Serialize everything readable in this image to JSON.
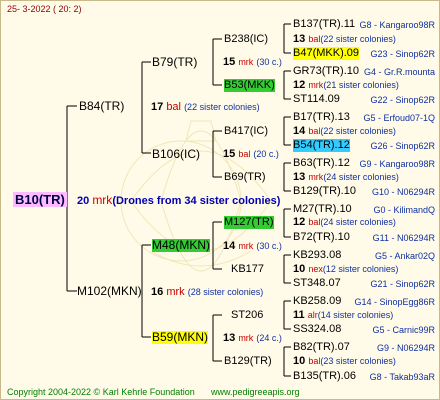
{
  "header": {
    "date": "25- 3-2022 ( 20: 2)"
  },
  "root": {
    "id": "B10(TR)",
    "drones_num": "20",
    "drones_abbr": "mrk",
    "drones_text": "(Drones from 34 sister colonies)"
  },
  "gen1": [
    {
      "id": "B84(TR)",
      "num": "17",
      "abbr": "bal",
      "sisters": "(22 sister colonies)"
    },
    {
      "id": "M102(MKN)",
      "num": "16",
      "abbr": "mrk",
      "sisters": "(28 sister colonies)"
    }
  ],
  "gen2": [
    {
      "id": "B79(TR)",
      "num": "15",
      "abbr": "mrk",
      "sisters": "(30 c.)"
    },
    {
      "id": "B106(IC)",
      "num": "15",
      "abbr": "bal",
      "sisters": "(20 c.)"
    },
    {
      "id": "M48(MKN)",
      "num": "14",
      "abbr": "mrk",
      "sisters": "(30 c.)"
    },
    {
      "id": "B59(MKN)",
      "num": "13",
      "abbr": "mrk",
      "sisters": "(24 c.)"
    }
  ],
  "gen3": [
    {
      "id": "B238(IC)",
      "num": "13",
      "abbr": "bal",
      "sisters": "(22 sister colonies)"
    },
    {
      "id": "B53(MKK)",
      "num": "12",
      "abbr": "mrk",
      "sisters": "(21 sister colonies)"
    },
    {
      "id": "B417(IC)",
      "num": "14",
      "abbr": "bal",
      "sisters": "(22 sister colonies)"
    },
    {
      "id": "B69(TR)",
      "num": "13",
      "abbr": "mrk",
      "sisters": "(24 sister colonies)"
    },
    {
      "id": "M127(TR)",
      "num": "12",
      "abbr": "bal",
      "sisters": "(24 sister colonies)"
    },
    {
      "id": "KB177",
      "num": "10",
      "abbr": "nex",
      "sisters": "(12 sister colonies)"
    },
    {
      "id": "ST206",
      "num": "11",
      "abbr": "alr",
      "sisters": "(14 sister colonies)"
    },
    {
      "id": "B129(TR)",
      "num": "10",
      "abbr": "bal",
      "sisters": "(23 sister colonies)"
    }
  ],
  "gen4": [
    {
      "id": "B137(TR).11",
      "line": "G8 - Kangaroo98R"
    },
    {
      "id": "B47(MKK).09",
      "line": "G23 - Sinop62R"
    },
    {
      "id": "GR73(TR).10",
      "line": "G4 - Gr.R.mounta"
    },
    {
      "id": "ST114.09",
      "line": "G22 - Sinop62R"
    },
    {
      "id": "B17(TR).13",
      "line": "G5 - Erfoud07-1Q"
    },
    {
      "id": "B54(TR).12",
      "line": "G26 - Sinop62R"
    },
    {
      "id": "B63(TR).12",
      "line": "G9 - Kangaroo98R"
    },
    {
      "id": "B129(TR).10",
      "line": "G10 - N06294R"
    },
    {
      "id": "M27(TR).10",
      "line": "G0 - KilimandQ"
    },
    {
      "id": "B72(TR).10",
      "line": "G11 - N06294R"
    },
    {
      "id": "KB293.08",
      "line": "G5 - Ankar02Q"
    },
    {
      "id": "ST348.07",
      "line": "G21 - Sinop62R"
    },
    {
      "id": "KB258.09",
      "line": "G14 - SinopEgg86R"
    },
    {
      "id": "SS324.08",
      "line": "G5 - Carnic99R"
    },
    {
      "id": "B82(TR).07",
      "line": "G9 - N06294R"
    },
    {
      "id": "B135(TR).06",
      "line": "G8 - Takab93aR"
    }
  ],
  "footer": {
    "copyright": "Copyright 2004-2022 © Karl Kehrle Foundation",
    "url": "www.pedigreeapis.org"
  }
}
